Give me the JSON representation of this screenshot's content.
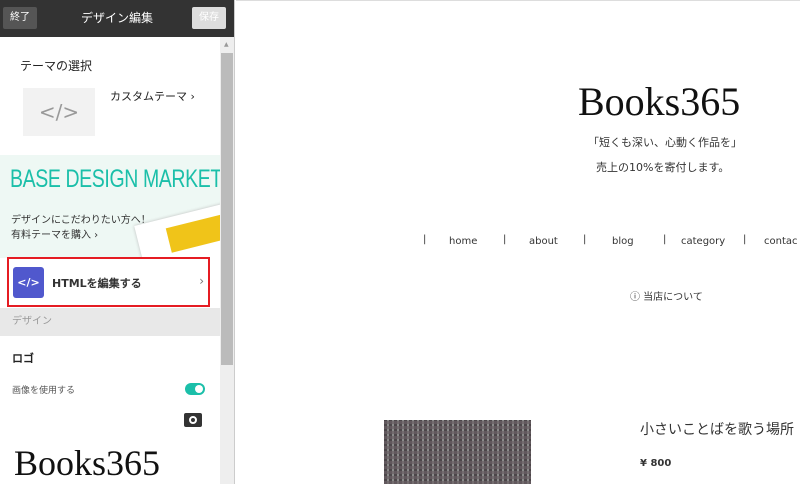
{
  "header": {
    "quit_label": "終了",
    "title": "デザイン編集",
    "save_label": "保存"
  },
  "theme": {
    "section_title": "テーマの選択",
    "thumb_icon": "</>",
    "current": "カスタムテーマ",
    "chevron": "›"
  },
  "banner": {
    "title": "BASE DESIGN MARKET",
    "line1": "デザインにこだわりたい方へ！",
    "line2": "有料テーマを購入 ›"
  },
  "html_edit": {
    "icon": "</>",
    "label": "HTMLを編集する",
    "chevron": "›"
  },
  "design_section": "デザイン",
  "logo": {
    "title": "ロゴ",
    "use_image_label": "画像を使用する",
    "use_image": true,
    "preview_text": "Books365"
  },
  "preview": {
    "brand": "Books365",
    "tagline1": "「短くも深い、心動く作品を」",
    "tagline2": "売上の10%を寄付します。",
    "nav": [
      "home",
      "about",
      "blog",
      "category",
      "contac"
    ],
    "separator": "|",
    "about_shop": "ⓘ 当店について",
    "product": {
      "title": "小さいことばを歌う場所",
      "price": "¥ 800"
    }
  },
  "colors": {
    "accent": "#1bbfa9",
    "html_icon": "#5058cd",
    "highlight": "#e51c23"
  }
}
